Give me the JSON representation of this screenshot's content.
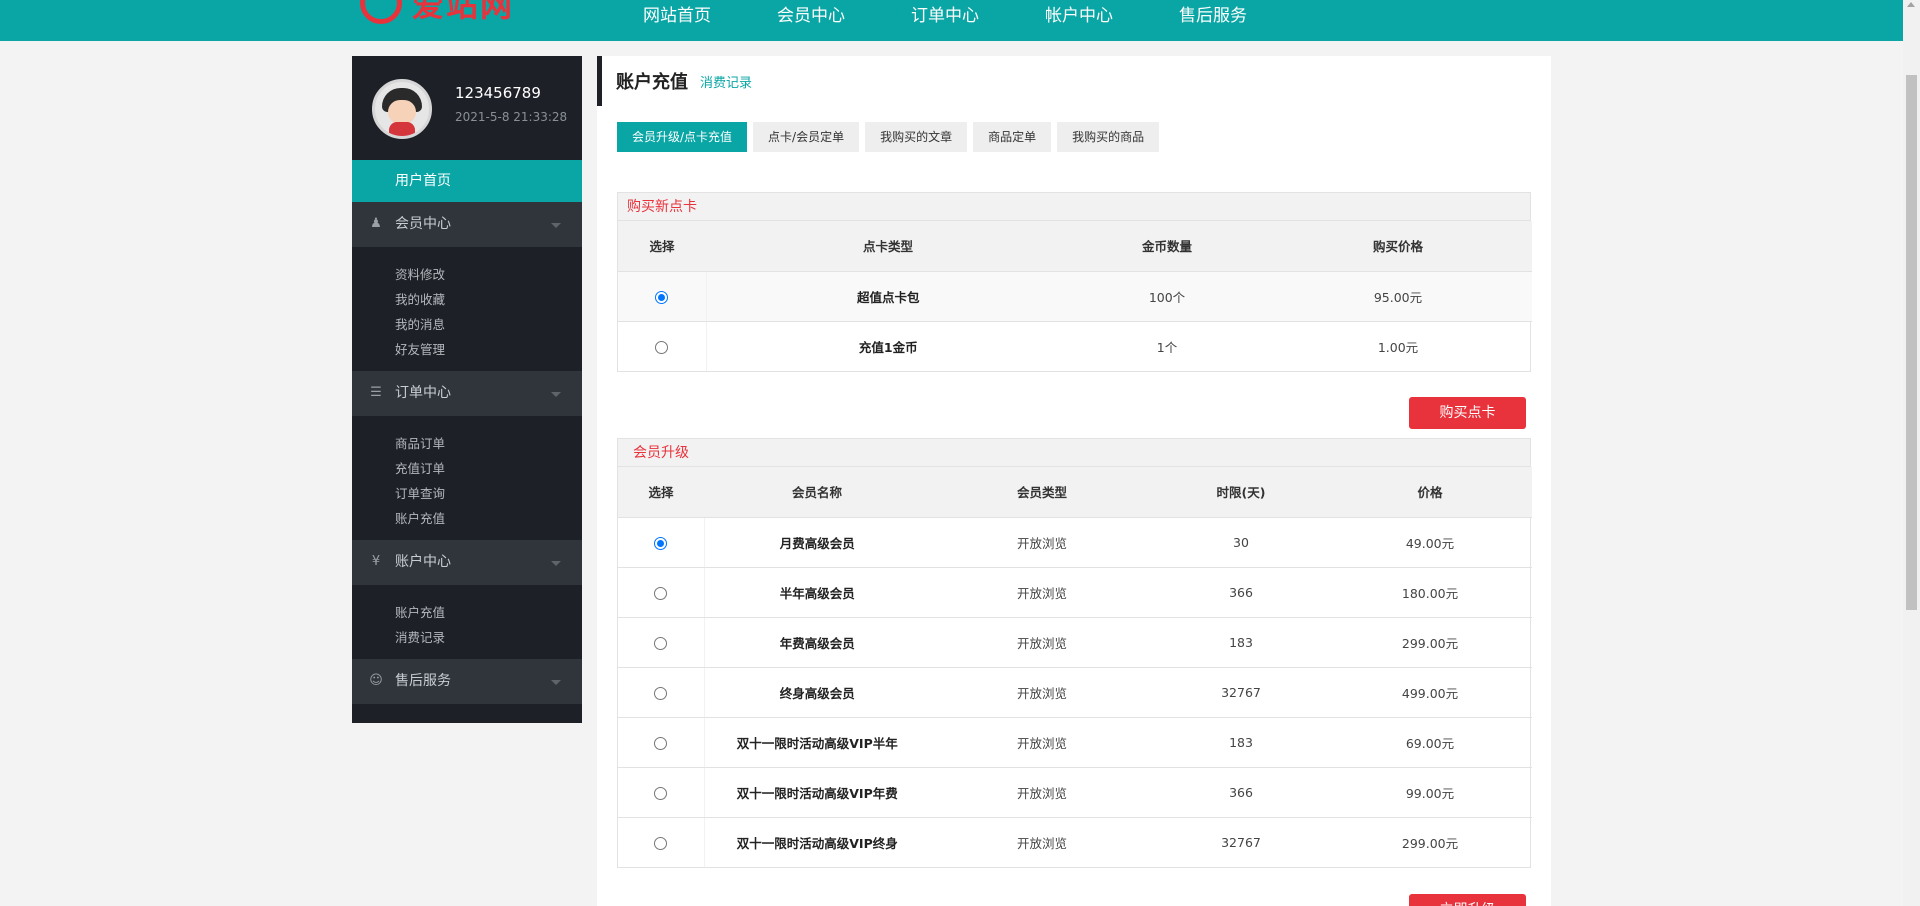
{
  "site": {
    "logo_text": "爱站网",
    "nav": [
      "网站首页",
      "会员中心",
      "订单中心",
      "帐户中心",
      "售后服务"
    ]
  },
  "user": {
    "name": "123456789",
    "login_time": "2021-5-8 21:33:28"
  },
  "sidebar": {
    "home": "用户首页",
    "groups": [
      {
        "title": "会员中心",
        "icon": "user-icon",
        "items": [
          "资料修改",
          "我的收藏",
          "我的消息",
          "好友管理"
        ]
      },
      {
        "title": "订单中心",
        "icon": "list-icon",
        "items": [
          "商品订单",
          "充值订单",
          "订单查询",
          "账户充值"
        ]
      },
      {
        "title": "账户中心",
        "icon": "coin-icon",
        "items": [
          "账户充值",
          "消费记录"
        ]
      },
      {
        "title": "售后服务",
        "icon": "smile-icon",
        "items": []
      }
    ]
  },
  "main": {
    "title": "账户充值",
    "link": "消费记录",
    "tabs": [
      "会员升级/点卡充值",
      "点卡/会员定单",
      "我购买的文章",
      "商品定单",
      "我购买的商品"
    ],
    "active_tab": 0
  },
  "card_section": {
    "title": "购买新点卡",
    "headers": [
      "选择",
      "点卡类型",
      "金币数量",
      "购买价格"
    ],
    "rows": [
      {
        "selected": true,
        "type": "超值点卡包",
        "coins": "100个",
        "price": "95.00元"
      },
      {
        "selected": false,
        "type": "充值1金币",
        "coins": "1个",
        "price": "1.00元"
      }
    ],
    "button": "购买点卡"
  },
  "vip_section": {
    "title": "会员升级",
    "headers": [
      "选择",
      "会员名称",
      "会员类型",
      "时限(天)",
      "价格"
    ],
    "rows": [
      {
        "selected": true,
        "name": "月费高级会员",
        "kind": "开放浏览",
        "days": "30",
        "price": "49.00元"
      },
      {
        "selected": false,
        "name": "半年高级会员",
        "kind": "开放浏览",
        "days": "366",
        "price": "180.00元"
      },
      {
        "selected": false,
        "name": "年费高级会员",
        "kind": "开放浏览",
        "days": "183",
        "price": "299.00元"
      },
      {
        "selected": false,
        "name": "终身高级会员",
        "kind": "开放浏览",
        "days": "32767",
        "price": "499.00元"
      },
      {
        "selected": false,
        "name": "双十一限时活动高级VIP半年",
        "kind": "开放浏览",
        "days": "183",
        "price": "69.00元"
      },
      {
        "selected": false,
        "name": "双十一限时活动高级VIP年费",
        "kind": "开放浏览",
        "days": "366",
        "price": "99.00元"
      },
      {
        "selected": false,
        "name": "双十一限时活动高级VIP终身",
        "kind": "开放浏览",
        "days": "32767",
        "price": "299.00元"
      }
    ],
    "button": "立即升级"
  },
  "colors": {
    "accent": "#0aa6a5",
    "danger": "#e8323c",
    "sidebar": "#1d2127"
  }
}
